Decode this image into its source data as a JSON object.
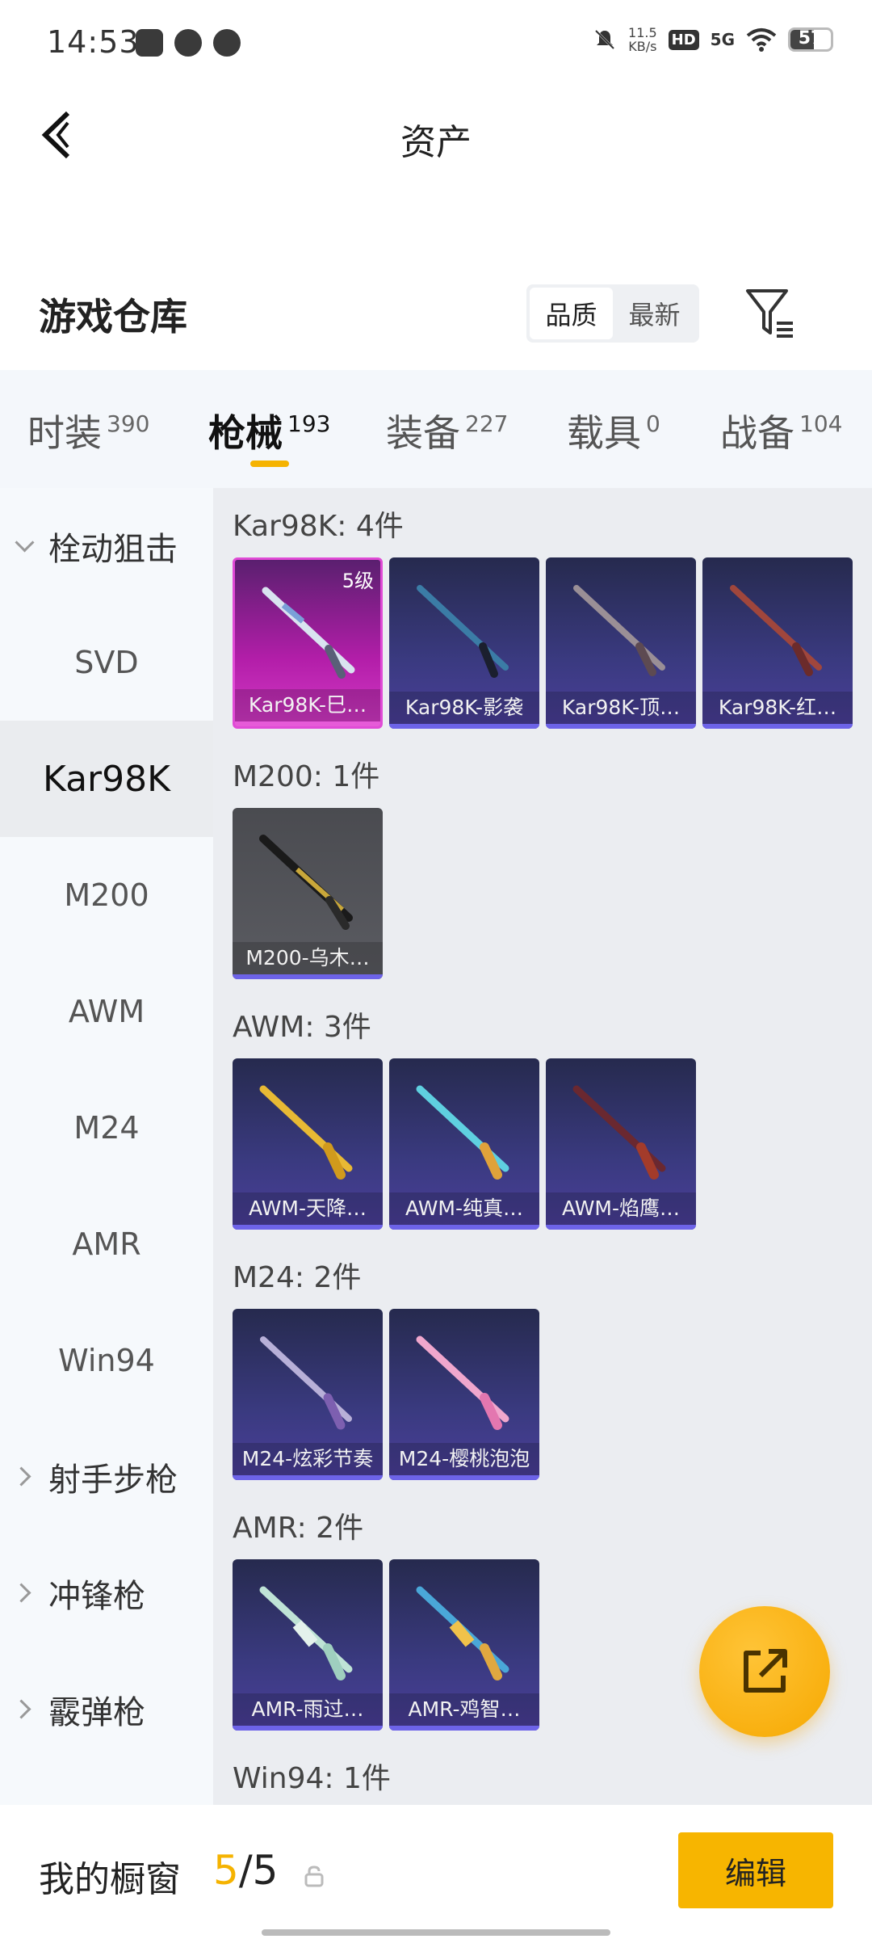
{
  "status_bar": {
    "time": "14:53",
    "net_rate": "11.5",
    "net_unit": "KB/s",
    "hd": "HD",
    "net_type": "5G",
    "battery": "57"
  },
  "header": {
    "title": "资产"
  },
  "warehouse": {
    "title": "游戏仓库",
    "sort_options": [
      "品质",
      "最新"
    ],
    "sort_selected": "品质"
  },
  "tabs": [
    {
      "label": "时装",
      "count": "390"
    },
    {
      "label": "枪械",
      "count": "193"
    },
    {
      "label": "装备",
      "count": "227"
    },
    {
      "label": "载具",
      "count": "0"
    },
    {
      "label": "战备",
      "count": "104"
    }
  ],
  "sidebar": {
    "items": [
      {
        "label": "栓动狙击"
      },
      {
        "label": "SVD"
      },
      {
        "label": "Kar98K"
      },
      {
        "label": "M200"
      },
      {
        "label": "AWM"
      },
      {
        "label": "M24"
      },
      {
        "label": "AMR"
      },
      {
        "label": "Win94"
      },
      {
        "label": "射手步枪"
      },
      {
        "label": "冲锋枪"
      },
      {
        "label": "霰弹枪"
      }
    ]
  },
  "groups": [
    {
      "title": "Kar98K: 4件",
      "items": [
        {
          "name": "Kar98K-巳…",
          "level": "5级"
        },
        {
          "name": "Kar98K-影袭"
        },
        {
          "name": "Kar98K-顶…"
        },
        {
          "name": "Kar98K-红…"
        }
      ]
    },
    {
      "title": "M200: 1件",
      "items": [
        {
          "name": "M200-乌木…"
        }
      ]
    },
    {
      "title": "AWM: 3件",
      "items": [
        {
          "name": "AWM-天降…"
        },
        {
          "name": "AWM-纯真…"
        },
        {
          "name": "AWM-焰鹰…"
        }
      ]
    },
    {
      "title": "M24: 2件",
      "items": [
        {
          "name": "M24-炫彩节奏"
        },
        {
          "name": "M24-樱桃泡泡"
        }
      ]
    },
    {
      "title": "AMR: 2件",
      "items": [
        {
          "name": "AMR-雨过…"
        },
        {
          "name": "AMR-鸡智…"
        }
      ]
    },
    {
      "title": "Win94: 1件",
      "items": []
    }
  ],
  "showcase": {
    "label": "我的橱窗",
    "count": "5",
    "total": "/5",
    "edit_label": "编辑"
  }
}
